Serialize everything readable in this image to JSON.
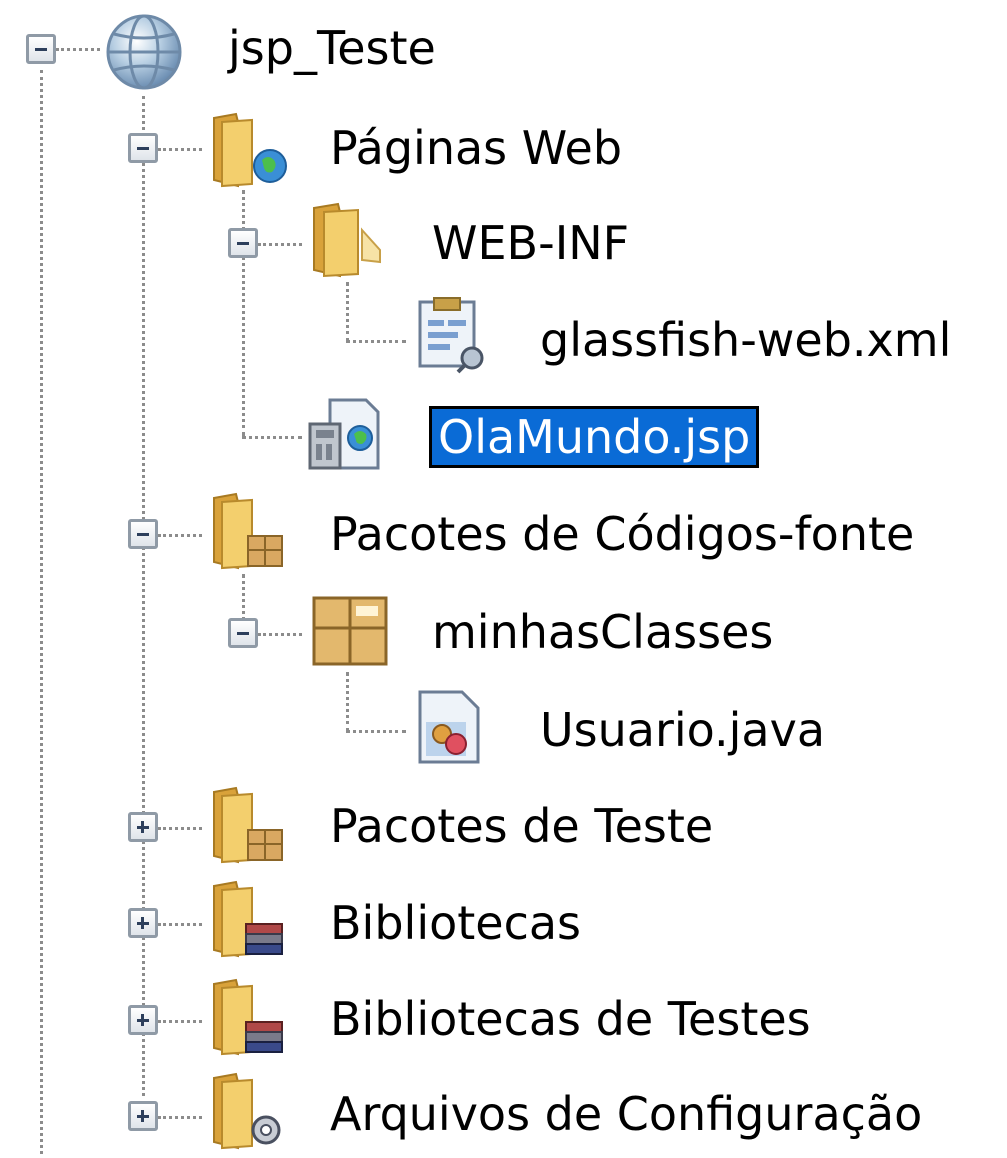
{
  "tree": {
    "root": {
      "label": "jsp_Teste",
      "expanded": true,
      "icon": "globe-project-icon"
    },
    "paginas_web": {
      "label": "Páginas Web",
      "expanded": true,
      "icon": "web-folder-icon"
    },
    "web_inf": {
      "label": "WEB-INF",
      "expanded": true,
      "icon": "folder-icon"
    },
    "glassfish": {
      "label": "glassfish-web.xml",
      "icon": "xml-config-file-icon"
    },
    "olamundo": {
      "label": "OlaMundo.jsp",
      "selected": true,
      "icon": "jsp-file-icon"
    },
    "pacotes_codigos": {
      "label": "Pacotes de Códigos-fonte",
      "expanded": true,
      "icon": "source-packages-folder-icon"
    },
    "minhas_classes": {
      "label": "minhasClasses",
      "expanded": true,
      "icon": "package-icon"
    },
    "usuario": {
      "label": "Usuario.java",
      "icon": "java-file-icon"
    },
    "pacotes_teste": {
      "label": "Pacotes de Teste",
      "expanded": false,
      "icon": "test-packages-folder-icon"
    },
    "bibliotecas": {
      "label": "Bibliotecas",
      "expanded": false,
      "icon": "libraries-folder-icon"
    },
    "bibliotecas_testes": {
      "label": "Bibliotecas de Testes",
      "expanded": false,
      "icon": "test-libraries-folder-icon"
    },
    "arquivos_config": {
      "label": "Arquivos de Configuração",
      "expanded": false,
      "icon": "config-files-folder-icon"
    }
  },
  "colors": {
    "selection": "#0a6bd6",
    "connector": "#8c8c8c",
    "folder": "#e8b84a"
  }
}
